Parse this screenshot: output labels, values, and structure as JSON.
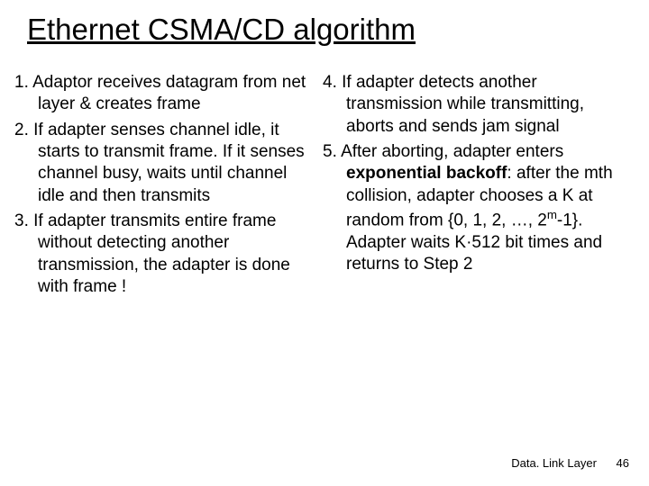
{
  "title": "Ethernet CSMA/CD algorithm",
  "left": {
    "i1": "1. Adaptor receives datagram from net layer & creates frame",
    "i2": "2. If adapter senses channel idle, it starts to transmit frame. If it senses channel busy, waits until channel idle and then transmits",
    "i3": "3. If adapter transmits entire frame without detecting another transmission, the adapter is done with frame !"
  },
  "right": {
    "i4": "4. If adapter detects another transmission while transmitting,  aborts and sends jam signal",
    "i5a": "5. After aborting, adapter enters ",
    "i5b": "exponential backoff",
    "i5c": ": after the mth collision, adapter chooses a K at random from {0, 1, 2, …, 2",
    "i5d": "m",
    "i5e": "-1}. Adapter waits K·512 bit times and returns to Step 2"
  },
  "footer": {
    "label": "Data. Link Layer",
    "page": "46"
  }
}
